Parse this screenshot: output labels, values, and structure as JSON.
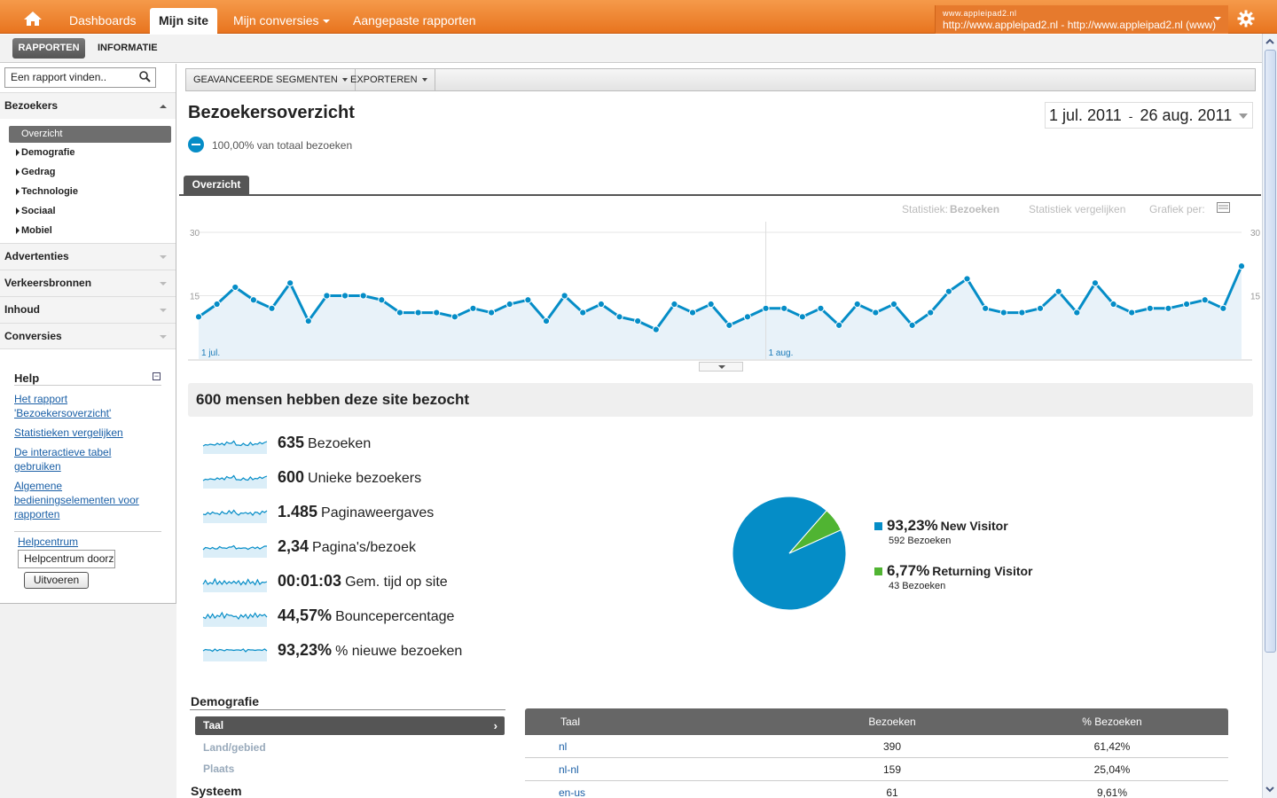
{
  "topbar": {
    "nav": [
      {
        "label": "Dashboards"
      },
      {
        "label": "Mijn site"
      },
      {
        "label": "Mijn conversies"
      },
      {
        "label": "Aangepaste rapporten"
      }
    ],
    "account_name": "www.appleipad2.nl",
    "account_url": "http://www.appleipad2.nl - http://www.appleipad2.nl (www)"
  },
  "subbar": {
    "rapporten": "RAPPORTEN",
    "informatie": "INFORMATIE"
  },
  "sidebar": {
    "search_value": "Een rapport vinden..",
    "sections": [
      {
        "label": "Bezoekers"
      },
      {
        "label": "Advertenties"
      },
      {
        "label": "Verkeersbronnen"
      },
      {
        "label": "Inhoud"
      },
      {
        "label": "Conversies"
      }
    ],
    "active_item": "Overzicht",
    "sub_items": [
      "Demografie",
      "Gedrag",
      "Technologie",
      "Sociaal",
      "Mobiel"
    ],
    "help": {
      "title": "Help",
      "links": [
        "Het rapport 'Bezoekersoverzicht'",
        "Statistieken vergelijken",
        "De interactieve tabel gebruiken",
        "Algemene bedieningselementen voor rapporten"
      ],
      "helpcentrum_link": "Helpcentrum",
      "helpcentrum_input": "Helpcentrum doorzoeken",
      "submit": "Uitvoeren"
    }
  },
  "toolbar": {
    "segments": "GEAVANCEERDE SEGMENTEN",
    "export": "EXPORTEREN"
  },
  "header": {
    "title": "Bezoekersoverzicht",
    "date_start": "1 jul. 2011",
    "date_sep": "-",
    "date_end": "26 aug. 2011",
    "segment": "100,00% van totaal bezoeken"
  },
  "tab": "Overzicht",
  "chart_controls": {
    "statistic_label": "Statistiek:",
    "statistic_value": "Bezoeken",
    "compare": "Statistiek vergelijken",
    "chart_per": "Grafiek per:"
  },
  "chart_data": {
    "type": "area",
    "series": [
      {
        "name": "Bezoeken",
        "values": [
          10,
          13,
          17,
          14,
          12,
          18,
          9,
          15,
          15,
          15,
          14,
          11,
          11,
          11,
          10,
          12,
          11,
          13,
          14,
          9,
          15,
          11,
          13,
          10,
          9,
          7,
          13,
          11,
          13,
          8,
          10,
          12,
          12,
          10,
          12,
          8,
          13,
          11,
          13,
          8,
          11,
          16,
          19,
          12,
          11,
          11,
          12,
          16,
          11,
          18,
          13,
          11,
          12,
          12,
          13,
          14,
          12,
          22
        ]
      }
    ],
    "x_labels": [
      {
        "label": "1 jul.",
        "index": 0
      },
      {
        "label": "1 aug.",
        "index": 31
      }
    ],
    "ylim": [
      0,
      30
    ],
    "y_ticks": [
      15,
      30
    ],
    "color": "#058dc7"
  },
  "summary": {
    "headline": "600 mensen hebben deze site bezocht",
    "metrics": [
      {
        "value": "635",
        "label": "Bezoeken"
      },
      {
        "value": "600",
        "label": "Unieke bezoekers"
      },
      {
        "value": "1.485",
        "label": "Paginaweergaves"
      },
      {
        "value": "2,34",
        "label": "Pagina's/bezoek"
      },
      {
        "value": "00:01:03",
        "label": "Gem. tijd op site"
      },
      {
        "value": "44,57%",
        "label": "Bouncepercentage"
      },
      {
        "value": "93,23%",
        "label": "% nieuwe bezoeken"
      }
    ]
  },
  "pie": {
    "slices": [
      {
        "label": "New Visitor",
        "percent_label": "93,23%",
        "visits": "592 Bezoeken",
        "value": 93.23,
        "color": "#058dc7"
      },
      {
        "label": "Returning Visitor",
        "percent_label": "6,77%",
        "visits": "43 Bezoeken",
        "value": 6.77,
        "color": "#50b432"
      }
    ]
  },
  "demografie": {
    "title": "Demografie",
    "items": [
      "Taal",
      "Land/gebied",
      "Plaats"
    ],
    "system_title": "Systeem"
  },
  "table": {
    "headers": [
      "Taal",
      "Bezoeken",
      "% Bezoeken"
    ],
    "rows": [
      {
        "lang": "nl",
        "visits": "390",
        "pct": "61,42%"
      },
      {
        "lang": "nl-nl",
        "visits": "159",
        "pct": "25,04%"
      },
      {
        "lang": "en-us",
        "visits": "61",
        "pct": "9,61%"
      }
    ]
  }
}
